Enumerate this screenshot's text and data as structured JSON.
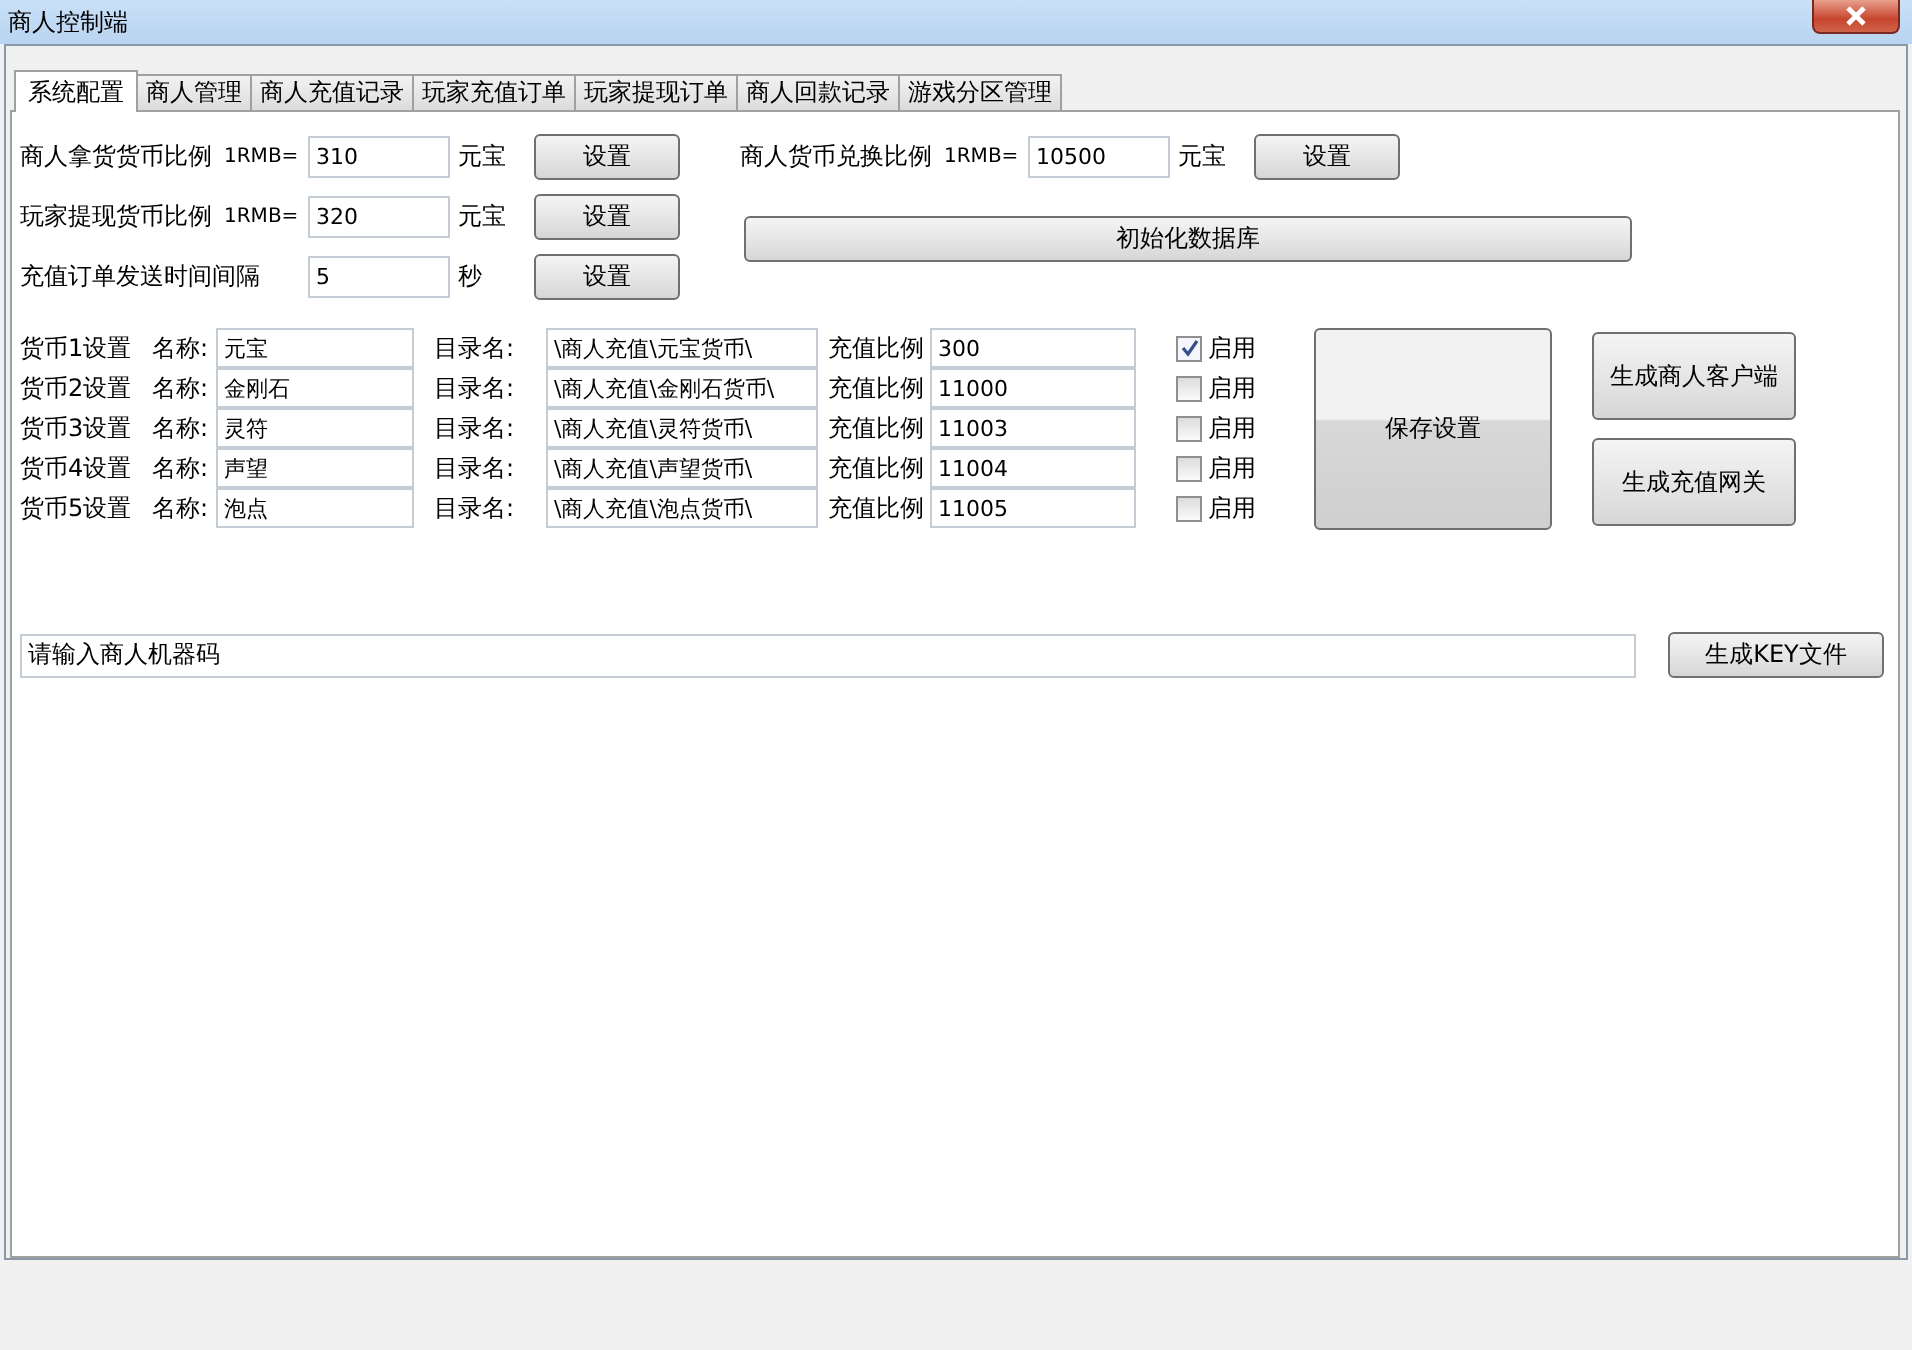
{
  "window": {
    "title": "商人控制端"
  },
  "tabs": [
    {
      "label": "系统配置",
      "selected": true
    },
    {
      "label": "商人管理",
      "selected": false
    },
    {
      "label": "商人充值记录",
      "selected": false
    },
    {
      "label": "玩家充值订单",
      "selected": false
    },
    {
      "label": "玩家提现订单",
      "selected": false
    },
    {
      "label": "商人回款记录",
      "selected": false
    },
    {
      "label": "游戏分区管理",
      "selected": false
    }
  ],
  "settings": [
    {
      "label": "商人拿货货币比例",
      "prefix": "1RMB=",
      "value": "310",
      "unit": "元宝",
      "button": "设置"
    },
    {
      "label": "玩家提现货币比例",
      "prefix": "1RMB=",
      "value": "320",
      "unit": "元宝",
      "button": "设置"
    },
    {
      "label": "充值订单发送时间间隔",
      "value": "5",
      "unit": "秒",
      "button": "设置"
    }
  ],
  "exchange": {
    "label": "商人货币兑换比例",
    "prefix": "1RMB=",
    "value": "10500",
    "unit": "元宝",
    "button": "设置"
  },
  "init_button": "初始化数据库",
  "currencies": [
    {
      "label": "货币1设置",
      "name_label": "名称:",
      "name": "元宝",
      "dir_label": "目录名:",
      "dir": "\\商人充值\\元宝货币\\",
      "ratio_label": "充值比例",
      "ratio": "300",
      "enable_label": "启用",
      "checked": true
    },
    {
      "label": "货币2设置",
      "name_label": "名称:",
      "name": "金刚石",
      "dir_label": "目录名:",
      "dir": "\\商人充值\\金刚石货币\\",
      "ratio_label": "充值比例",
      "ratio": "11000",
      "enable_label": "启用",
      "checked": false
    },
    {
      "label": "货币3设置",
      "name_label": "名称:",
      "name": "灵符",
      "dir_label": "目录名:",
      "dir": "\\商人充值\\灵符货币\\",
      "ratio_label": "充值比例",
      "ratio": "11003",
      "enable_label": "启用",
      "checked": false
    },
    {
      "label": "货币4设置",
      "name_label": "名称:",
      "name": "声望",
      "dir_label": "目录名:",
      "dir": "\\商人充值\\声望货币\\",
      "ratio_label": "充值比例",
      "ratio": "11004",
      "enable_label": "启用",
      "checked": false
    },
    {
      "label": "货币5设置",
      "name_label": "名称:",
      "name": "泡点",
      "dir_label": "目录名:",
      "dir": "\\商人充值\\泡点货币\\",
      "ratio_label": "充值比例",
      "ratio": "11005",
      "enable_label": "启用",
      "checked": false
    }
  ],
  "save_button": "保存设置",
  "side_buttons": [
    "生成商人客户端",
    "生成充值网关"
  ],
  "key_field": {
    "value": "请输入商人机器码"
  },
  "key_button": "生成KEY文件"
}
